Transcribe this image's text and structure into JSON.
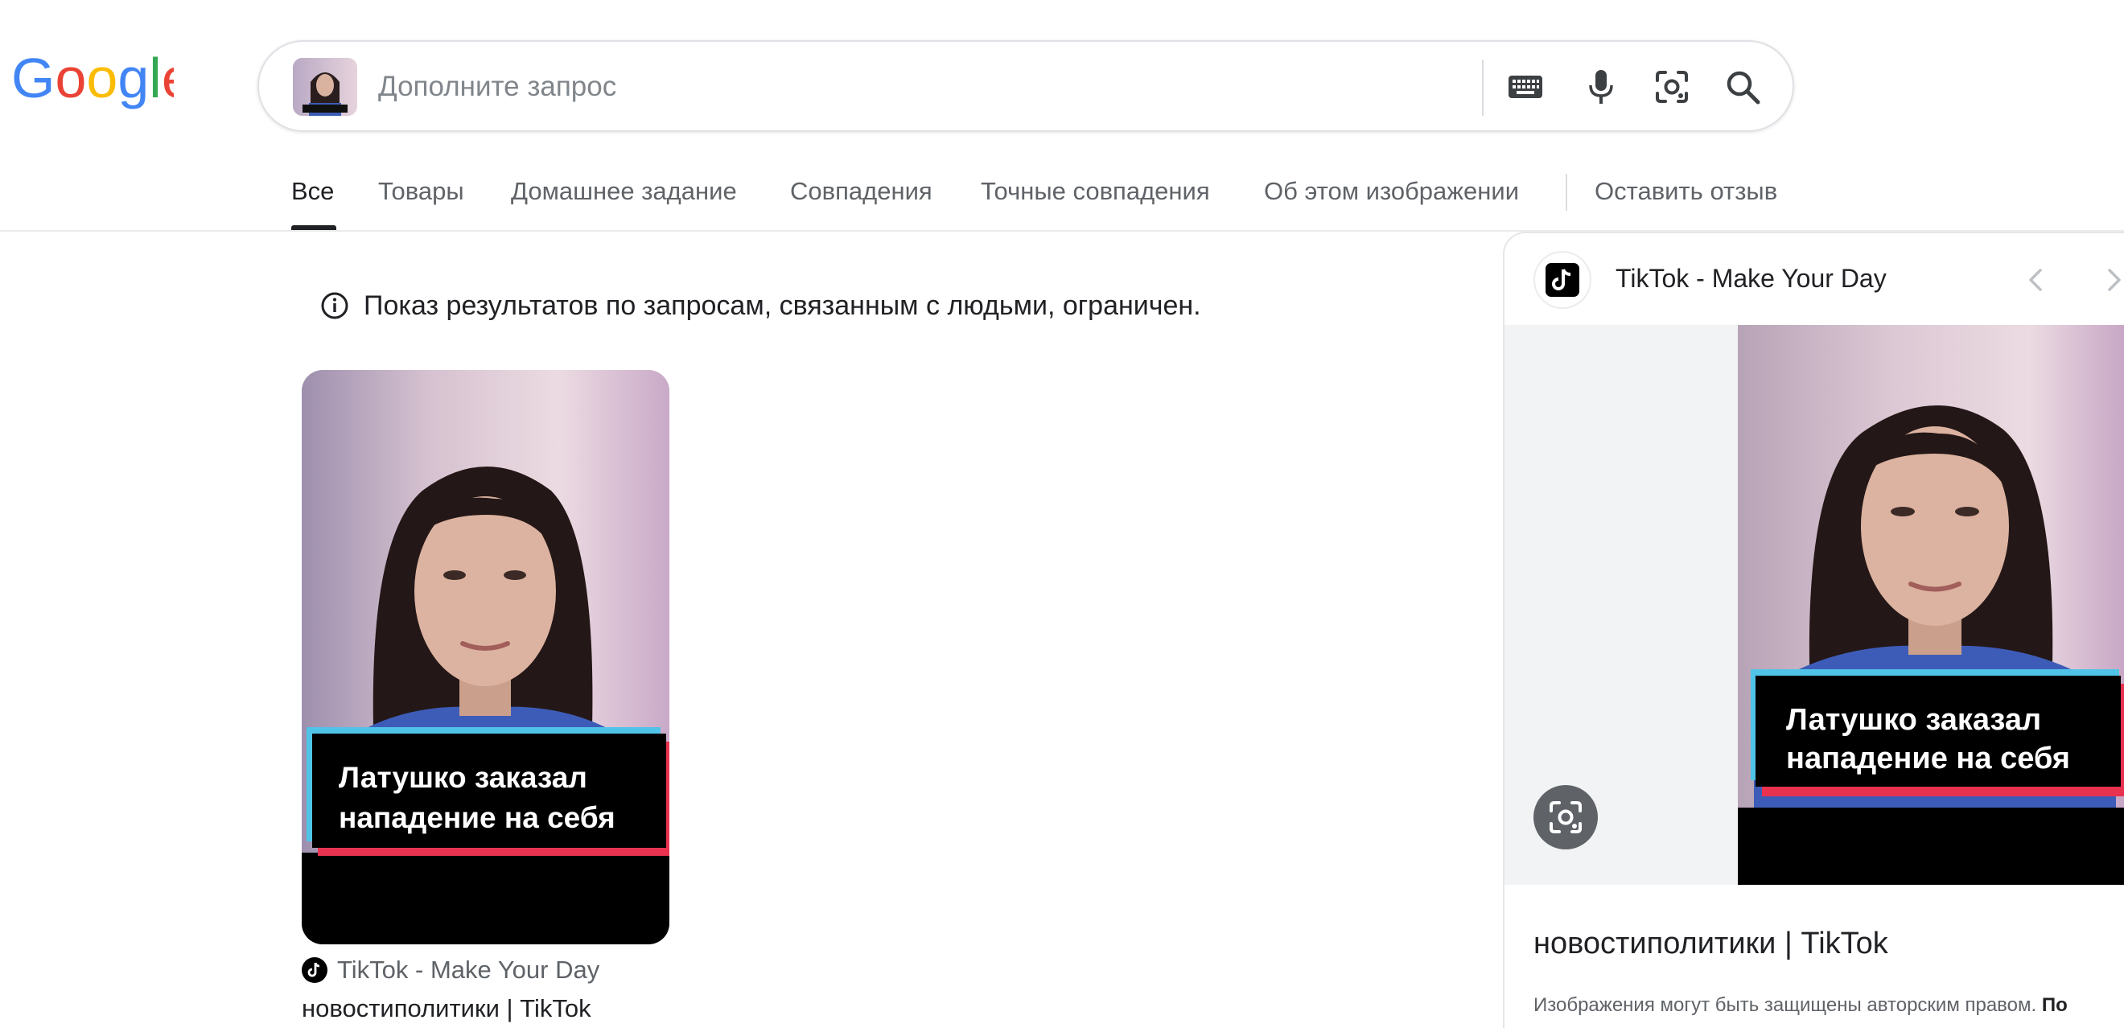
{
  "logo": {
    "text": "Google",
    "letters": [
      "G",
      "o",
      "o",
      "g",
      "l",
      "e"
    ],
    "colors": [
      "#4285F4",
      "#EA4335",
      "#FBBC05",
      "#4285F4",
      "#34A853",
      "#EA4335"
    ]
  },
  "search": {
    "placeholder": "Дополните запрос",
    "value": "",
    "icons": [
      "close-icon",
      "keyboard-icon",
      "mic-icon",
      "lens-icon",
      "search-icon"
    ]
  },
  "tabs": [
    {
      "label": "Все",
      "active": true
    },
    {
      "label": "Товары",
      "active": false
    },
    {
      "label": "Домашнее задание",
      "active": false
    },
    {
      "label": "Совпадения",
      "active": false
    },
    {
      "label": "Точные совпадения",
      "active": false
    },
    {
      "label": "Об этом изображении",
      "active": false
    },
    {
      "label": "Оставить отзыв",
      "active": false
    }
  ],
  "notice": {
    "text": "Показ результатов по запросам, связанным с людьми, ограничен.",
    "icon": "info-icon"
  },
  "result": {
    "caption_line1": "Латушко заказал",
    "caption_line2": "нападение на себя",
    "source": "TikTok - Make Your Day",
    "title": "новостиполитики | TikTok"
  },
  "panel": {
    "site": "TikTok - Make Your Day",
    "caption_line1": "Латушко заказал",
    "caption_line2": "нападение на себя",
    "title": "новостиполитики | TikTok",
    "copyright": "Изображения могут быть защищены авторским правом.",
    "copyright_more": "По"
  },
  "colors": {
    "accent_blue": "#1a73e8",
    "text": "#202124",
    "muted": "#5f6368",
    "caption_cyan": "#4fc3e8",
    "caption_red": "#e8324f"
  }
}
